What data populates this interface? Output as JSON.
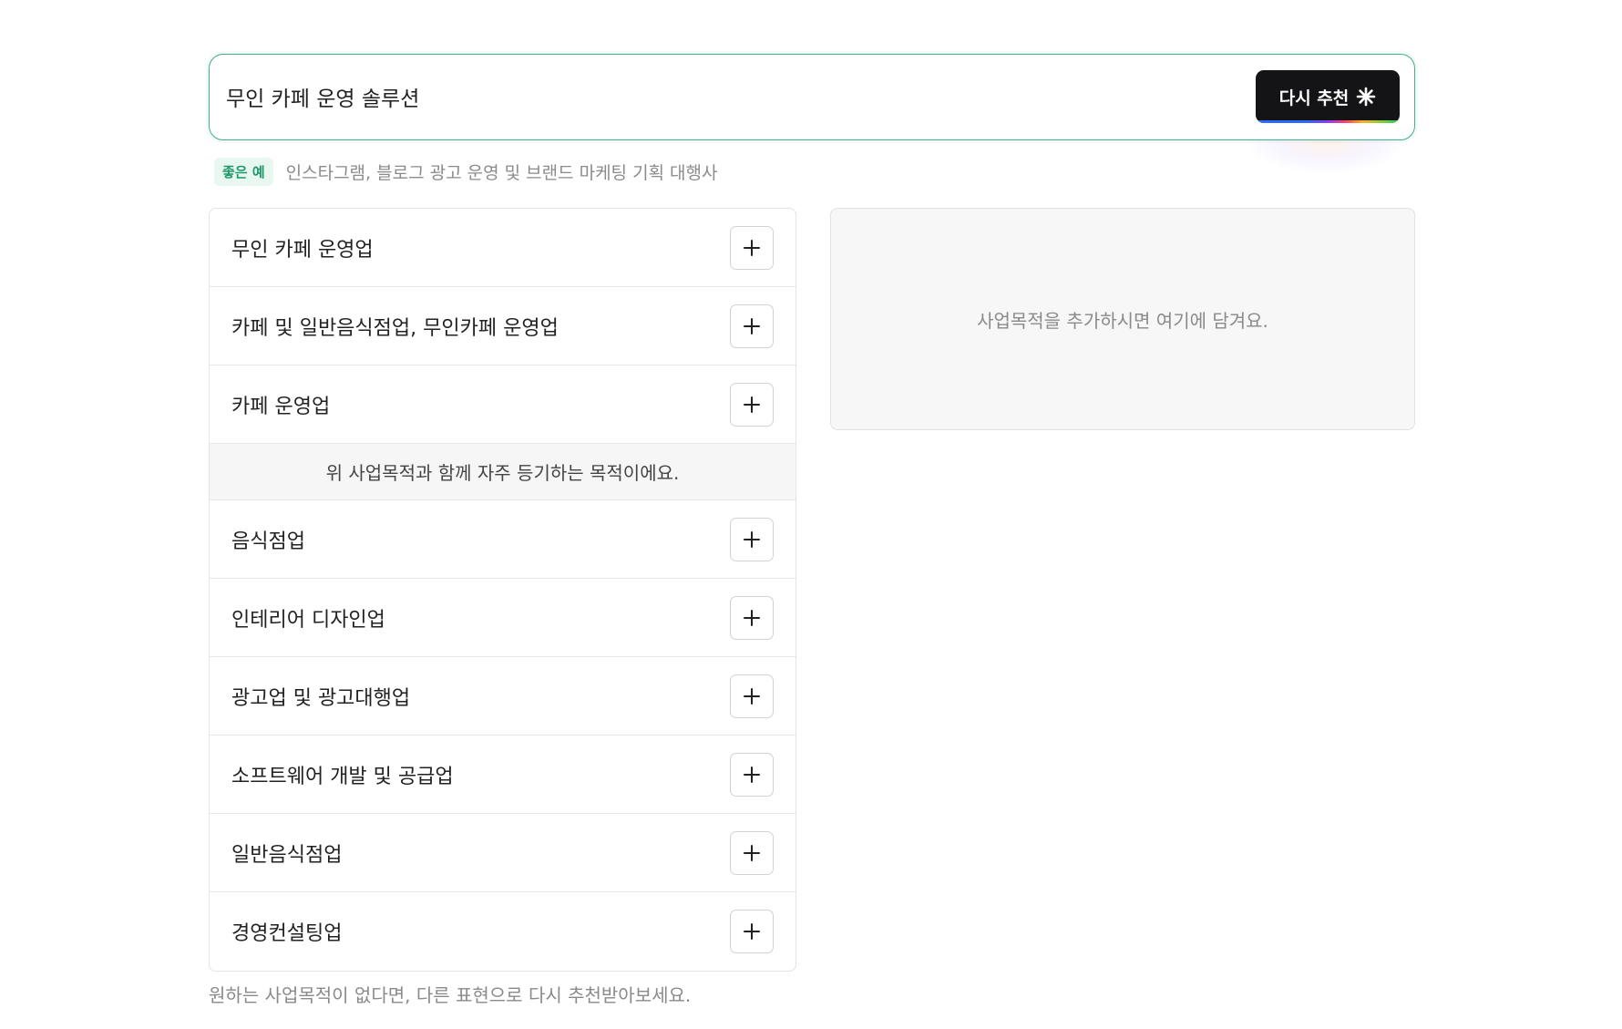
{
  "search": {
    "value": "무인 카페 운영 솔루션",
    "button_label": "다시 추천"
  },
  "hint": {
    "badge": "좋은 예",
    "text": "인스타그램, 블로그 광고 운영 및 브랜드 마케팅 기획 대행사"
  },
  "suggestions": {
    "primary": [
      {
        "label": "무인 카페 운영업"
      },
      {
        "label": "카페 및 일반음식점업, 무인카페 운영업"
      },
      {
        "label": "카페 운영업"
      }
    ],
    "related_note": "위 사업목적과 함께 자주 등기하는 목적이에요.",
    "related": [
      {
        "label": "음식점업"
      },
      {
        "label": "인테리어 디자인업"
      },
      {
        "label": "광고업 및 광고대행업"
      },
      {
        "label": "소프트웨어 개발 및 공급업"
      },
      {
        "label": "일반음식점업"
      },
      {
        "label": "경영컨설팅업"
      }
    ]
  },
  "selected_panel": {
    "empty_text": "사업목적을 추가하시면 여기에 담겨요."
  },
  "footer": {
    "text": "원하는 사업목적이 없다면, 다른 표현으로 다시 추천받아보세요."
  },
  "icons": {
    "add": "plus-icon",
    "recommend": "sparkle-icon"
  },
  "colors": {
    "accent_green": "#3fae8c",
    "badge_green": "#1e9a6a",
    "button_dark": "#141416"
  }
}
